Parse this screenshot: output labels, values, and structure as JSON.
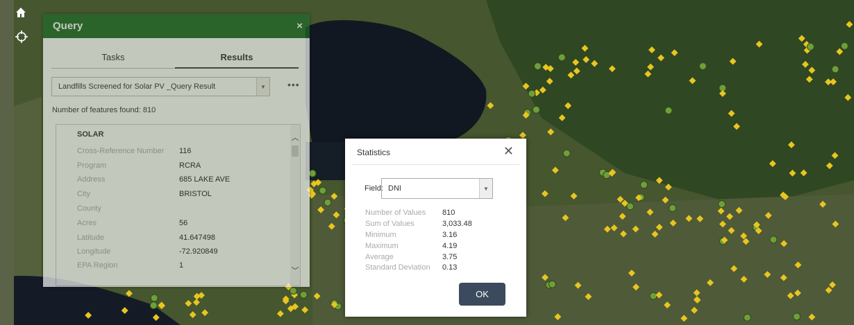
{
  "map": {
    "home_icon": "home-icon",
    "locate_icon": "locate-icon",
    "colors": {
      "marker_yellow": "#e8c520",
      "marker_green": "#6f9e3a"
    }
  },
  "query": {
    "title": "Query",
    "close": "×",
    "tabs": [
      {
        "label": "Tasks",
        "active": false
      },
      {
        "label": "Results",
        "active": true
      }
    ],
    "layer_select": "Landfills Screened for Solar PV _Query Result",
    "more": "•••",
    "features_found": "Number of features found: 810",
    "result": {
      "heading": "SOLAR",
      "fields": [
        {
          "label": "Cross-Reference Number",
          "value": "116"
        },
        {
          "label": "Program",
          "value": "RCRA"
        },
        {
          "label": "Address",
          "value": "685 LAKE AVE"
        },
        {
          "label": "City",
          "value": "BRISTOL"
        },
        {
          "label": "County",
          "value": ""
        },
        {
          "label": "Acres",
          "value": "56"
        },
        {
          "label": "Latitude",
          "value": "41.647498"
        },
        {
          "label": "Longitude",
          "value": "-72.920849"
        },
        {
          "label": "EPA Region",
          "value": "1"
        }
      ]
    },
    "header_color": "#1f6b2a"
  },
  "stats": {
    "title": "Statistics",
    "close": "✕",
    "field_label": "Field:",
    "field_value": "DNI",
    "rows": [
      {
        "label": "Number of Values",
        "value": "810"
      },
      {
        "label": "Sum of Values",
        "value": "3,033.48"
      },
      {
        "label": "Minimum",
        "value": "3.16"
      },
      {
        "label": "Maximum",
        "value": "4.19"
      },
      {
        "label": "Average",
        "value": "3.75"
      },
      {
        "label": "Standard Deviation",
        "value": "0.13"
      }
    ],
    "ok_label": "OK",
    "ok_color": "#3b4a5c"
  }
}
